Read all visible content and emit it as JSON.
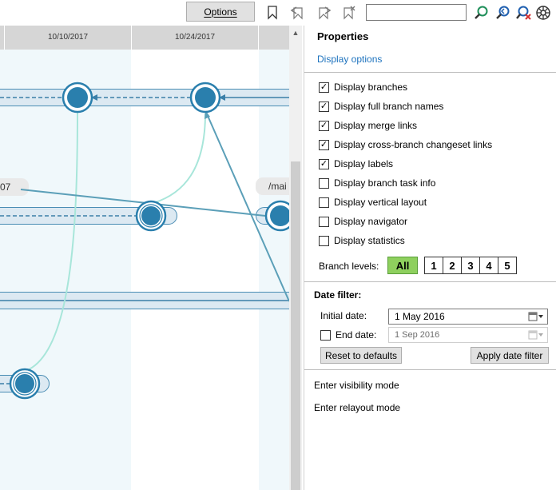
{
  "toolbar": {
    "options_label": "Options",
    "search_value": ""
  },
  "timeline": {
    "dates": [
      "10/10/2017",
      "10/24/2017"
    ]
  },
  "graph": {
    "labels": [
      "07",
      "/mai"
    ]
  },
  "properties": {
    "title": "Properties",
    "display_options_link": "Display options",
    "checkboxes": [
      {
        "label": "Display branches",
        "checked": true
      },
      {
        "label": "Display full branch names",
        "checked": true
      },
      {
        "label": "Display merge links",
        "checked": true
      },
      {
        "label": "Display cross-branch changeset links",
        "checked": true
      },
      {
        "label": "Display labels",
        "checked": true
      },
      {
        "label": "Display branch task info",
        "checked": false
      },
      {
        "label": "Display vertical layout",
        "checked": false
      },
      {
        "label": "Display navigator",
        "checked": false
      },
      {
        "label": "Display statistics",
        "checked": false
      }
    ],
    "branch_levels": {
      "label": "Branch levels:",
      "options": [
        "All",
        "1",
        "2",
        "3",
        "4",
        "5"
      ],
      "selected": "All"
    },
    "date_filter": {
      "title": "Date filter:",
      "initial_label": "Initial date:",
      "initial_value": "1 May 2016",
      "end_label": "End date:",
      "end_checked": false,
      "end_value": "1 Sep 2016",
      "reset_label": "Reset to defaults",
      "apply_label": "Apply date filter"
    },
    "actions": [
      "Enter visibility mode",
      "Enter relayout mode"
    ]
  },
  "colors": {
    "branch_stroke": "#4a8db4",
    "changeset_fill": "#2a7fad",
    "merge_link": "#a8e6da",
    "accent_link": "#1e73be",
    "level_selected": "#8ed05e"
  }
}
